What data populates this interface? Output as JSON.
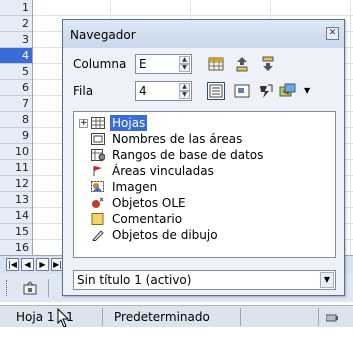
{
  "sheet": {
    "rows": [
      "1",
      "2",
      "3",
      "4",
      "5",
      "6",
      "7",
      "8",
      "9",
      "10",
      "11",
      "12",
      "13",
      "14",
      "15",
      "16"
    ],
    "selected_row": "4"
  },
  "navigator": {
    "title": "Navegador",
    "column_label": "Columna",
    "column_value": "E",
    "row_label": "Fila",
    "row_value": "4",
    "tree": [
      {
        "label": "Hojas",
        "icon": "sheet-grid-icon"
      },
      {
        "label": "Nombres de las áreas",
        "icon": "range-names-icon"
      },
      {
        "label": "Rangos de base de datos",
        "icon": "database-range-icon"
      },
      {
        "label": "Áreas vinculadas",
        "icon": "linked-area-icon"
      },
      {
        "label": "Imagen",
        "icon": "image-icon"
      },
      {
        "label": "Objetos OLE",
        "icon": "ole-object-icon"
      },
      {
        "label": "Comentario",
        "icon": "comment-icon"
      },
      {
        "label": "Objetos de dibujo",
        "icon": "drawing-object-icon"
      }
    ],
    "document": "Sin título 1 (activo)"
  },
  "statusbar": {
    "sheet": "Hoja 1 / 1",
    "style": "Predeterminado"
  },
  "colors": {
    "selection": "#3b6bd6",
    "title_bar": "#c9d7ec"
  }
}
